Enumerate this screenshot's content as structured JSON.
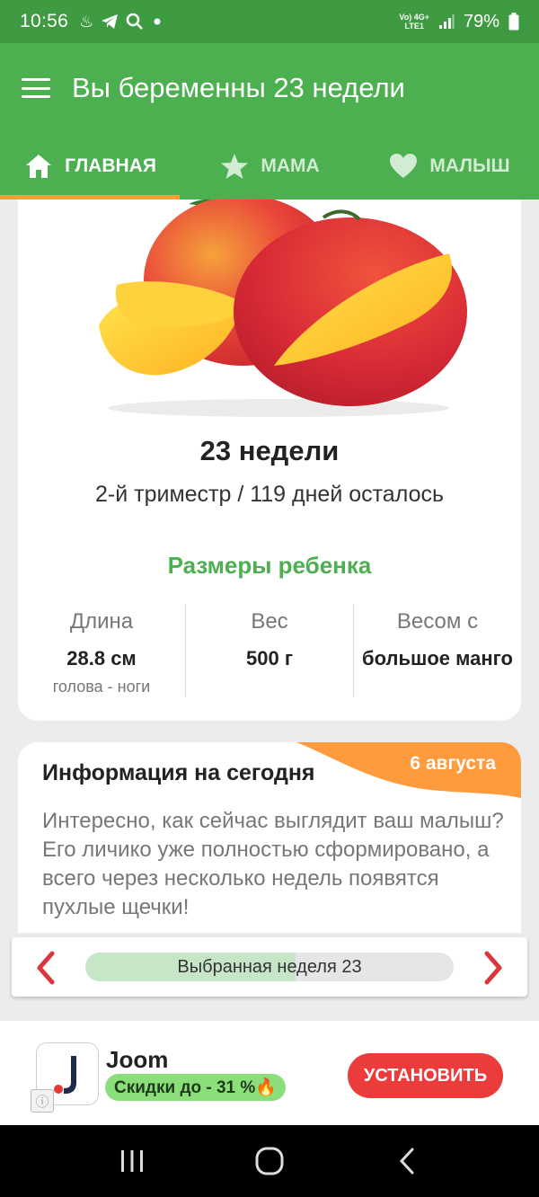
{
  "status_bar": {
    "time": "10:56",
    "notification_icons": [
      "person-icon",
      "telegram-icon",
      "search-icon",
      "dot-icon"
    ],
    "network_label_top": "Vo) 4G+",
    "network_label_bottom": "LTE1",
    "battery": "79%"
  },
  "app_bar": {
    "title": "Вы беременны 23 недели"
  },
  "tabs": [
    {
      "label": "ГЛАВНАЯ",
      "icon": "home-icon",
      "active": true
    },
    {
      "label": "МАМА",
      "icon": "star-icon",
      "active": false
    },
    {
      "label": "МАЛЫШ",
      "icon": "heart-icon",
      "active": false
    }
  ],
  "week_card": {
    "fruit_image": "mango-illustration",
    "title": "23 недели",
    "subtitle": "2-й триместр / 119 дней осталось",
    "sizes_heading": "Размеры ребенка",
    "stats": [
      {
        "label": "Длина",
        "value": "28.8 см",
        "note": "голова - ноги"
      },
      {
        "label": "Вес",
        "value": "500 г",
        "note": ""
      },
      {
        "label": "Весом с",
        "value": "большое манго",
        "note": ""
      }
    ]
  },
  "info_card": {
    "title": "Информация на сегодня",
    "date": "6 августа",
    "body": "Интересно, как сейчас выглядит ваш малыш? Его личико уже полностью сформировано, а всего через несколько недель появятся пухлые щечки!"
  },
  "week_picker": {
    "label": "Выбранная неделя 23",
    "progress_fraction": 0.57
  },
  "ad": {
    "name": "Joom",
    "description": "Скидки до - 31 %🔥",
    "button": "УСТАНОВИТЬ",
    "info_glyph": "ⓘ"
  },
  "colors": {
    "status_bar": "#3e9b42",
    "primary": "#4caf50",
    "accent": "#ff9b3d",
    "arrow_red": "#d9363e",
    "install_button": "#ec3b3b"
  }
}
